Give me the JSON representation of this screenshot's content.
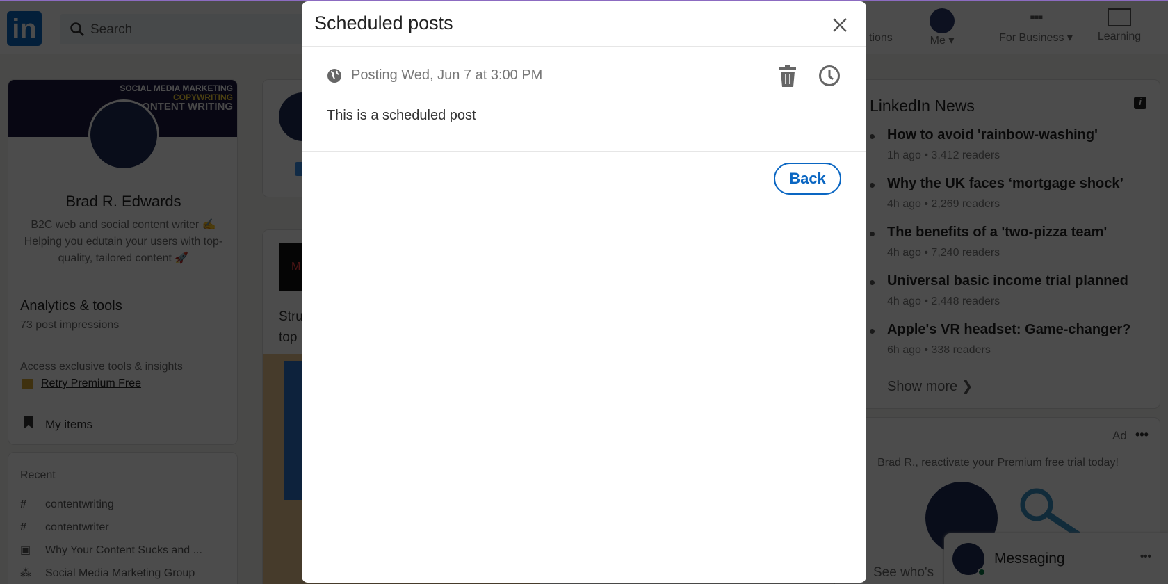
{
  "nav": {
    "logo": "in",
    "search_placeholder": "Search",
    "notifications_label": "tions",
    "me_label": "Me ▾",
    "business_label": "For Business ▾",
    "learning_label": "Learning"
  },
  "profile": {
    "banner_lines": [
      "SOCIAL MEDIA MARKETING",
      "COPYWRITING",
      "CONTENT WRITING"
    ],
    "name": "Brad R. Edwards",
    "headline": "B2C web and social content writer ✍️ Helping you edutain your users with top-quality, tailored content 🚀",
    "analytics_title": "Analytics & tools",
    "impressions": "73 post impressions",
    "premium_prompt": "Access exclusive tools & insights",
    "premium_link": "Retry Premium Free",
    "my_items": "My items"
  },
  "recent": {
    "title": "Recent",
    "items": [
      {
        "icon": "hashtag-icon",
        "label": "contentwriting"
      },
      {
        "icon": "hashtag-icon",
        "label": "contentwriter"
      },
      {
        "icon": "calendar-icon",
        "label": "Why Your Content Sucks and ..."
      },
      {
        "icon": "group-icon",
        "label": "Social Media Marketing Group"
      }
    ]
  },
  "middle": {
    "text_line1": "Stru",
    "text_line2": "top",
    "thumb_text": "M"
  },
  "news": {
    "title": "LinkedIn News",
    "items": [
      {
        "title": "How to avoid 'rainbow-washing'",
        "meta": "1h ago • 3,412 readers"
      },
      {
        "title": "Why the UK faces ‘mortgage shock’",
        "meta": "4h ago • 2,269 readers"
      },
      {
        "title": "The benefits of a 'two-pizza team'",
        "meta": "4h ago • 7,240 readers"
      },
      {
        "title": "Universal basic income trial planned",
        "meta": "4h ago • 2,448 readers"
      },
      {
        "title": "Apple's VR headset: Game-changer?",
        "meta": "6h ago • 338 readers"
      }
    ],
    "show_more": "Show more ❯"
  },
  "ad": {
    "label": "Ad",
    "text": "Brad R., reactivate your Premium free trial today!",
    "see_who": "See who's"
  },
  "messaging": {
    "label": "Messaging"
  },
  "modal": {
    "title": "Scheduled posts",
    "schedule": "Posting Wed, Jun 7 at 3:00 PM",
    "post_text": "This is a scheduled post",
    "back_label": "Back"
  },
  "colors": {
    "brand": "#0a66c2",
    "overlay": "rgba(0,0,0,0.74)",
    "accent_line": "#8c6bc1"
  }
}
